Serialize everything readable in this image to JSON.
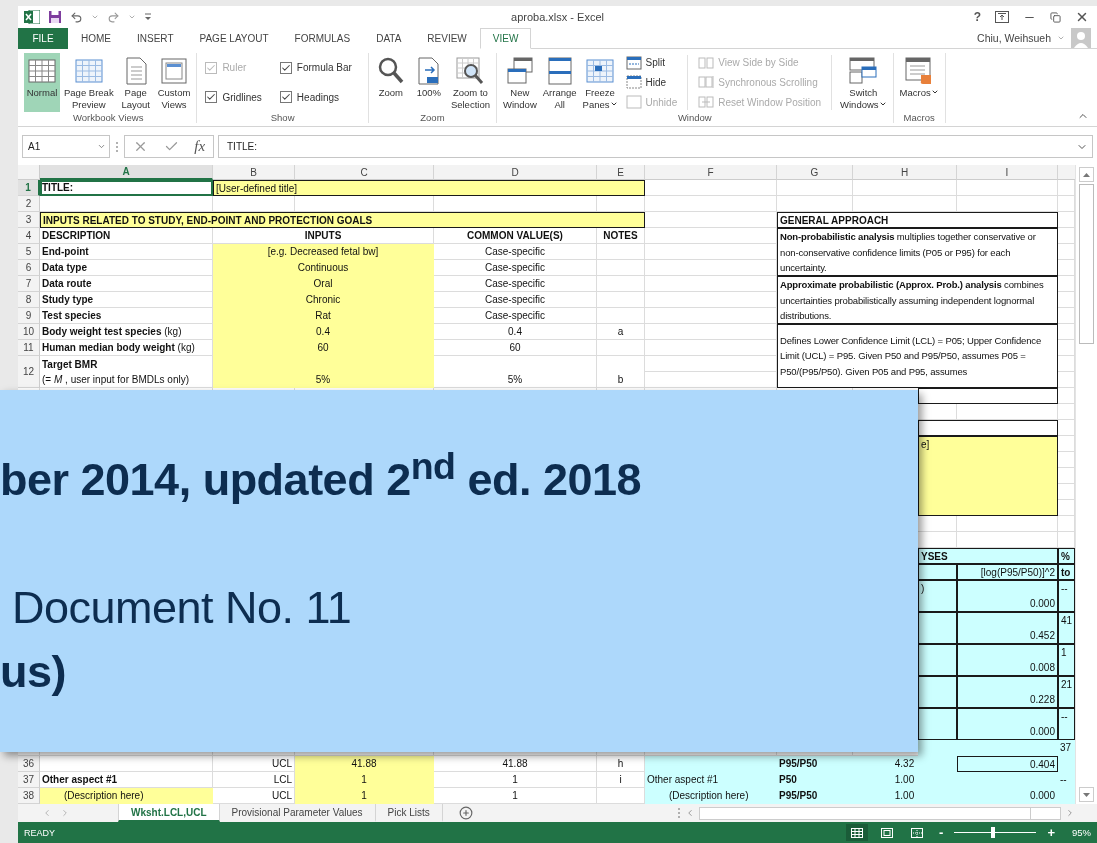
{
  "window": {
    "title": "aproba.xlsx - Excel",
    "help": "?",
    "user": "Chiu, Weihsueh"
  },
  "ribbon_tabs": [
    {
      "label": "FILE",
      "kind": "file",
      "selected": false
    },
    {
      "label": "HOME",
      "kind": "tab",
      "selected": false
    },
    {
      "label": "INSERT",
      "kind": "tab",
      "selected": false
    },
    {
      "label": "PAGE LAYOUT",
      "kind": "tab",
      "selected": false
    },
    {
      "label": "FORMULAS",
      "kind": "tab",
      "selected": false
    },
    {
      "label": "DATA",
      "kind": "tab",
      "selected": false
    },
    {
      "label": "REVIEW",
      "kind": "tab",
      "selected": false
    },
    {
      "label": "VIEW",
      "kind": "tab",
      "selected": true
    }
  ],
  "ribbon_groups": [
    {
      "label": "Workbook Views",
      "items": [
        {
          "kind": "large",
          "label": "Normal",
          "selected": true
        },
        {
          "kind": "large",
          "label": "Page Break\nPreview",
          "selected": false
        },
        {
          "kind": "large",
          "label": "Page\nLayout",
          "selected": false
        },
        {
          "kind": "large",
          "label": "Custom\nViews",
          "selected": false
        }
      ]
    },
    {
      "label": "Show",
      "items": [
        {
          "kind": "stack",
          "items": [
            {
              "kind": "check",
              "label": "Ruler",
              "checked": true,
              "disabled": true
            },
            {
              "kind": "check",
              "label": "Gridlines",
              "checked": true,
              "disabled": false
            }
          ]
        },
        {
          "kind": "stack",
          "items": [
            {
              "kind": "check",
              "label": "Formula Bar",
              "checked": true,
              "disabled": false
            },
            {
              "kind": "check",
              "label": "Headings",
              "checked": true,
              "disabled": false
            }
          ]
        }
      ]
    },
    {
      "label": "Zoom",
      "items": [
        {
          "kind": "large",
          "label": "Zoom"
        },
        {
          "kind": "large",
          "label": "100%"
        },
        {
          "kind": "large",
          "label": "Zoom to\nSelection"
        }
      ]
    },
    {
      "label": "Window",
      "items": [
        {
          "kind": "large",
          "label": "New\nWindow"
        },
        {
          "kind": "large",
          "label": "Arrange\nAll"
        },
        {
          "kind": "large",
          "label": "Freeze\nPanes",
          "dropdown": true
        },
        {
          "kind": "stack",
          "items": [
            {
              "kind": "small",
              "label": "Split",
              "disabled": false
            },
            {
              "kind": "small",
              "label": "Hide",
              "disabled": false
            },
            {
              "kind": "small",
              "label": "Unhide",
              "disabled": true
            }
          ]
        },
        {
          "kind": "stack",
          "divider": true,
          "items": [
            {
              "kind": "small",
              "label": "View Side by Side",
              "disabled": true
            },
            {
              "kind": "small",
              "label": "Synchronous Scrolling",
              "disabled": true
            },
            {
              "kind": "small",
              "label": "Reset Window Position",
              "disabled": true
            }
          ]
        },
        {
          "kind": "large",
          "label": "Switch\nWindows",
          "dropdown": true,
          "divider": true
        }
      ]
    },
    {
      "label": "Macros",
      "items": [
        {
          "kind": "large",
          "label": "Macros",
          "dropdown": true
        }
      ]
    }
  ],
  "formula_bar": {
    "name_box": "A1",
    "function_label": "fx",
    "formula": "TITLE:"
  },
  "sheet": {
    "columns": [
      {
        "letter": "A",
        "selected": true
      },
      {
        "letter": "B",
        "selected": false
      },
      {
        "letter": "C",
        "selected": false
      },
      {
        "letter": "D",
        "selected": false
      },
      {
        "letter": "E",
        "selected": false
      },
      {
        "letter": "F",
        "selected": false
      },
      {
        "letter": "G",
        "selected": false
      },
      {
        "letter": "H",
        "selected": false
      },
      {
        "letter": "I",
        "selected": false
      }
    ],
    "rows": [
      {
        "number": "1",
        "selected": true,
        "cells": [
          {
            "text": "TITLE:",
            "bold": true,
            "selected": true
          },
          {
            "text": "[User-defined title]",
            "kind": "input",
            "boxed": true,
            "selected": false
          }
        ]
      },
      {
        "number": "2",
        "selected": false
      },
      {
        "number": "3",
        "selected": false,
        "cells": [
          {
            "text": "INPUTS RELATED TO STUDY, END-POINT AND PROTECTION GOALS",
            "bold": true,
            "kind": "input",
            "boxed": true,
            "selected": false
          },
          {},
          {},
          {},
          {},
          {},
          {
            "text": "GENERAL APPROACH",
            "bold": true,
            "boxed": true,
            "selected": false
          }
        ]
      },
      {
        "number": "4",
        "selected": false,
        "cells": [
          {
            "text": "DESCRIPTION",
            "bold": true,
            "selected": false
          },
          {
            "text": "INPUTS",
            "bold": true,
            "center": true,
            "selected": false
          },
          {},
          {
            "text": "COMMON VALUE(S)",
            "bold": true,
            "center": true,
            "selected": false
          },
          {
            "text": "NOTES",
            "bold": true,
            "center": true,
            "selected": false
          },
          {},
          {
            "text": "**Non-probabilistic analysis** multiplies together conservative or non-conservative confidence limits (P05 or P95) for each uncertainty.",
            "wrap": true,
            "boxed": true,
            "top": true,
            "selected": false
          }
        ]
      },
      {
        "number": "5",
        "selected": false,
        "cells": [
          {
            "text": "End-point",
            "bold": true,
            "selected": false
          },
          {
            "text": "[e.g. Decreased fetal bw]",
            "kind": "input",
            "center": true,
            "selected": false
          },
          {},
          {
            "text": "Case-specific",
            "center": true,
            "selected": false
          }
        ]
      },
      {
        "number": "6",
        "selected": false,
        "cells": [
          {
            "text": "Data type",
            "bold": true,
            "selected": false
          },
          {
            "text": "Continuous",
            "kind": "input",
            "center": true,
            "selected": false
          },
          {},
          {
            "text": "Case-specific",
            "center": true,
            "selected": false
          }
        ]
      },
      {
        "number": "7",
        "selected": false,
        "cells": [
          {
            "text": "Data route",
            "bold": true,
            "selected": false
          },
          {
            "text": "Oral",
            "kind": "input",
            "center": true,
            "selected": false
          },
          {},
          {
            "text": "Case-specific",
            "center": true,
            "selected": false
          },
          {},
          {},
          {
            "text": "**Approximate probabilistic (Approx. Prob.) analysis** combines uncertainties probabilistically assuming independent lognormal distributions.",
            "wrap": true,
            "boxed": true,
            "top": true,
            "selected": false
          }
        ]
      },
      {
        "number": "8",
        "selected": false,
        "cells": [
          {
            "text": "Study type",
            "bold": true,
            "selected": false
          },
          {
            "text": "Chronic",
            "kind": "input",
            "center": true,
            "selected": false
          },
          {},
          {
            "text": "Case-specific",
            "center": true,
            "selected": false
          }
        ]
      },
      {
        "number": "9",
        "selected": false,
        "cells": [
          {
            "text": "Test species",
            "bold": true,
            "selected": false
          },
          {
            "text": "Rat",
            "kind": "input",
            "center": true,
            "selected": false
          },
          {},
          {
            "text": "Case-specific",
            "center": true,
            "selected": false
          }
        ]
      },
      {
        "number": "10",
        "selected": false,
        "cells": [
          {
            "text": "**Body weight test species** (kg)",
            "selected": false
          },
          {
            "text": "0.4",
            "kind": "input",
            "center": true,
            "selected": false
          },
          {},
          {
            "text": "0.4",
            "center": true,
            "selected": false
          },
          {
            "text": "a",
            "center": true,
            "selected": false
          },
          {},
          {
            "text": "Defines Lower Confidence Limit (LCL) = P05; Upper Confidence Limit (UCL) = P95. Given P50 and P95/P50, assumes P05 = P50/(P95/P50).  Given P05 and P95, assumes",
            "wrap": true,
            "boxed": true,
            "middle": true,
            "selected": false
          }
        ]
      },
      {
        "number": "11",
        "selected": false,
        "cells": [
          {
            "text": "**Human median body weight** (kg)",
            "selected": false
          },
          {
            "text": "60",
            "kind": "input",
            "center": true,
            "selected": false
          },
          {},
          {
            "text": "60",
            "center": true,
            "selected": false
          }
        ]
      },
      {
        "number": "12",
        "selected": false,
        "tall": true,
        "cells": [
          {
            "text": "**Target BMR**\n(= *M* , user input for BMDLs only)",
            "selected": false
          },
          {
            "text": "5%",
            "kind": "input",
            "center": true,
            "selected": false
          },
          {},
          {
            "text": "5%",
            "center": true,
            "selected": false
          },
          {
            "text": "b",
            "center": true,
            "selected": false
          }
        ]
      },
      {
        "cells": [
          {},
          {},
          {},
          {},
          {},
          {},
          {},
          {
            "cut": true,
            "boxed": true,
            "selected": false
          }
        ]
      },
      {},
      {
        "cells": [
          {},
          {},
          {},
          {},
          {},
          {},
          {},
          {
            "cut": true,
            "boxed": true,
            "selected": false
          }
        ]
      },
      {
        "cells": [
          {},
          {},
          {},
          {},
          {},
          {},
          {},
          {
            "text": "e]",
            "cut": true,
            "kind": "input",
            "boxed": true,
            "top": true,
            "selected": false
          }
        ]
      },
      {},
      {},
      {},
      {},
      {},
      {},
      {
        "cells": [
          {},
          {},
          {},
          {},
          {},
          {},
          {},
          {
            "text": "YSES",
            "cut": true,
            "bold": true,
            "kind": "analysis",
            "boxed": true,
            "selected": false
          },
          {},
          {
            "text": "%",
            "bold": true,
            "kind": "analysis",
            "boxed": true,
            "selected": false
          }
        ]
      },
      {
        "cells": [
          {},
          {},
          {},
          {},
          {},
          {},
          {},
          {
            "cut": true,
            "kind": "analysis",
            "boxed": true,
            "selected": false
          },
          {
            "text": "[log(P95/P50)]^2",
            "right": true,
            "kind": "analysis",
            "boxed": true,
            "selected": false
          },
          {
            "text": "to",
            "bold": true,
            "kind": "analysis",
            "boxed": true,
            "selected": false
          }
        ]
      },
      {
        "cells": [
          {},
          {},
          {},
          {},
          {},
          {},
          {},
          {
            "text": ")",
            "cut": true,
            "top": true,
            "kind": "analysis",
            "boxed": true,
            "selected": false
          },
          {
            "text": "0.000",
            "right": true,
            "kind": "analysis",
            "boxed": true,
            "selected": false
          },
          {
            "text": "--",
            "top": true,
            "kind": "analysis",
            "boxed": true,
            "selected": false
          }
        ]
      },
      {},
      {
        "cells": [
          {},
          {},
          {},
          {},
          {},
          {},
          {},
          {
            "cut": true,
            "kind": "analysis",
            "boxed": true,
            "selected": false
          },
          {
            "text": "0.452",
            "right": true,
            "kind": "analysis",
            "boxed": true,
            "selected": false
          },
          {
            "text": "41",
            "top": true,
            "kind": "analysis",
            "boxed": true,
            "selected": false
          }
        ]
      },
      {},
      {
        "cells": [
          {},
          {},
          {},
          {},
          {},
          {},
          {},
          {
            "cut": true,
            "kind": "analysis",
            "boxed": true,
            "selected": false
          },
          {
            "text": "0.008",
            "right": true,
            "kind": "analysis",
            "boxed": true,
            "selected": false
          },
          {
            "text": "1",
            "top": true,
            "kind": "analysis",
            "boxed": true,
            "selected": false
          }
        ]
      },
      {},
      {
        "cells": [
          {},
          {},
          {},
          {},
          {},
          {},
          {},
          {
            "cut": true,
            "kind": "analysis",
            "boxed": true,
            "selected": false
          },
          {
            "text": "0.228",
            "right": true,
            "kind": "analysis",
            "boxed": true,
            "selected": false
          },
          {
            "text": "21",
            "top": true,
            "kind": "analysis",
            "boxed": true,
            "selected": false
          }
        ]
      },
      {},
      {
        "cells": [
          {},
          {},
          {},
          {},
          {},
          {},
          {},
          {
            "cut": true,
            "kind": "analysis",
            "boxed": true,
            "selected": false
          },
          {
            "text": "0.000",
            "right": true,
            "kind": "analysis",
            "boxed": true,
            "selected": false
          },
          {
            "text": "--",
            "top": true,
            "kind": "analysis",
            "boxed": true,
            "selected": false
          }
        ]
      },
      {},
      {
        "cells": [
          {},
          {},
          {},
          {},
          {},
          {},
          {},
          {
            "cut": true,
            "kind": "analysis",
            "selected": false
          },
          {
            "kind": "analysis",
            "selected": false
          },
          {
            "text": "37",
            "kind": "analysis",
            "selected": false
          }
        ]
      },
      {
        "number": "36",
        "selected": false,
        "cells": [
          {},
          {
            "text": "UCL",
            "right": true,
            "selected": false
          },
          {
            "text": "41.88",
            "kind": "input",
            "center": true,
            "selected": false
          },
          {
            "text": "41.88",
            "center": true,
            "selected": false
          },
          {
            "text": "h",
            "center": true,
            "selected": false
          },
          {
            "kind": "analysis",
            "selected": false
          },
          {
            "text": "P95/P50",
            "bold": true,
            "kind": "analysis",
            "selected": false
          },
          {
            "text": "4.32",
            "center": true,
            "kind": "analysis",
            "selected": false
          },
          {
            "text": "0.404",
            "right": true,
            "kind": "analysis",
            "boxed": true,
            "selected": false
          },
          {
            "kind": "analysis",
            "selected": false
          }
        ]
      },
      {
        "number": "37",
        "selected": false,
        "cells": [
          {
            "text": "Other aspect #1",
            "bold": true,
            "selected": false
          },
          {
            "text": "LCL",
            "right": true,
            "selected": false
          },
          {
            "text": "1",
            "kind": "input",
            "center": true,
            "selected": false
          },
          {
            "text": "1",
            "center": true,
            "selected": false
          },
          {
            "text": "i",
            "center": true,
            "selected": false
          },
          {
            "text": "Other aspect #1",
            "kind": "analysis",
            "selected": false
          },
          {
            "text": "P50",
            "bold": true,
            "kind": "analysis",
            "selected": false
          },
          {
            "text": "1.00",
            "center": true,
            "kind": "analysis",
            "selected": false
          },
          {
            "text": "0.000",
            "right": true,
            "kind": "analysis",
            "selected": false
          },
          {
            "text": "--",
            "top": true,
            "kind": "analysis",
            "selected": false
          }
        ]
      },
      {
        "number": "38",
        "selected": false,
        "cells": [
          {
            "text": "(Description here)",
            "indent": true,
            "kind": "input",
            "selected": false
          },
          {
            "text": "UCL",
            "right": true,
            "selected": false
          },
          {
            "text": "1",
            "kind": "input",
            "center": true,
            "selected": false
          },
          {
            "text": "1",
            "center": true,
            "selected": false
          },
          {},
          {
            "text": "(Description here)",
            "indent": true,
            "kind": "analysis",
            "selected": false
          },
          {
            "text": "P95/P50",
            "bold": true,
            "kind": "analysis",
            "selected": false
          },
          {
            "text": "1.00",
            "center": true,
            "kind": "analysis",
            "selected": false
          }
        ]
      }
    ]
  },
  "sheet_tabs": [
    {
      "label": "Wksht.LCL,UCL",
      "selected": true
    },
    {
      "label": "Provisional Parameter Values",
      "selected": false
    },
    {
      "label": "Pick Lists",
      "selected": false
    }
  ],
  "status_bar": {
    "status": "READY",
    "views": [
      {
        "selected": true
      },
      {
        "selected": false
      },
      {
        "selected": false
      }
    ],
    "zoom_out": "-",
    "zoom_in": "+",
    "level": 0.47,
    "zoom": "95%"
  },
  "overlay": {
    "heading": {
      "text": "ber 2014, updated 2$^{nd}$ ed. 2018",
      "bold": true
    },
    "lines": [
      {
        "text": "Document No. 11",
        "bold": false,
        "indent": true
      },
      {
        "text": "us)",
        "bold": true
      }
    ]
  }
}
